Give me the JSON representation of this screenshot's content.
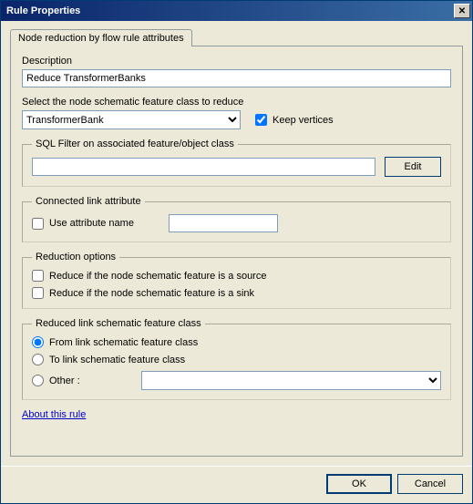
{
  "window": {
    "title": "Rule Properties"
  },
  "tab": {
    "label": "Node reduction by flow rule attributes"
  },
  "description": {
    "label": "Description",
    "value": "Reduce TransformerBanks"
  },
  "select_class": {
    "label": "Select the node schematic feature class to reduce",
    "value": "TransformerBank",
    "keep_vertices_label": "Keep vertices"
  },
  "sql_filter": {
    "legend": "SQL Filter on associated feature/object class",
    "value": "",
    "edit_label": "Edit"
  },
  "connected_link": {
    "legend": "Connected link attribute",
    "use_attr_label": "Use attribute name",
    "attr_value": ""
  },
  "reduction": {
    "legend": "Reduction options",
    "source_label": "Reduce if the node schematic feature is a source",
    "sink_label": "Reduce if the node schematic feature is a sink"
  },
  "reduced_link": {
    "legend": "Reduced link schematic feature class",
    "from_label": "From link schematic feature class",
    "to_label": "To link schematic feature class",
    "other_label": "Other :"
  },
  "about_link": "About this rule",
  "footer": {
    "ok_label": "OK",
    "cancel_label": "Cancel"
  }
}
